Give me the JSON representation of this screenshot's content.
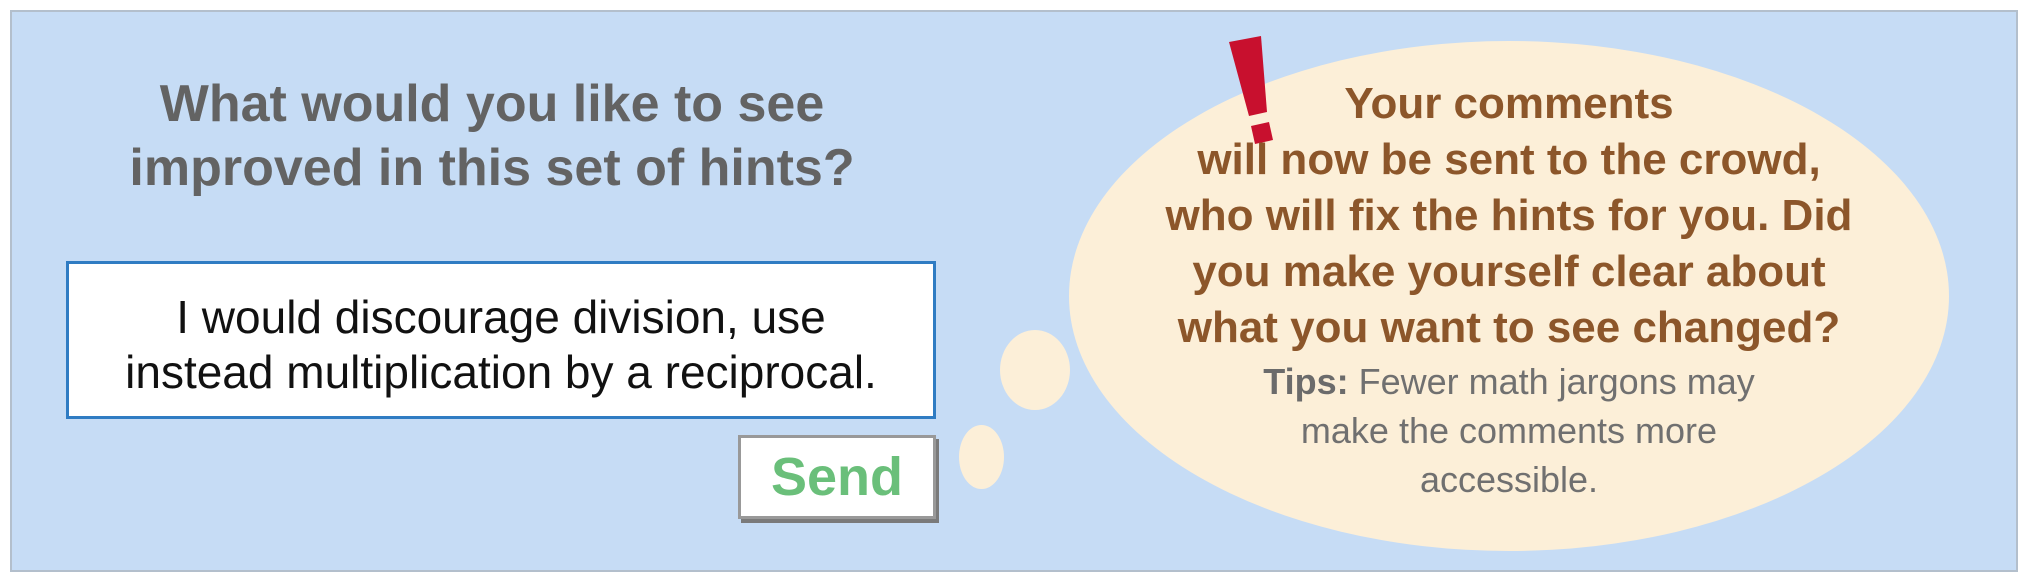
{
  "prompt": {
    "question_line1": "What would you like to see",
    "question_line2": "improved in this set of hints?"
  },
  "comment": {
    "value": "I would discourage division, use\ninstead multiplication by a reciprocal."
  },
  "send_button": {
    "label": "Send"
  },
  "bubble": {
    "icon": "exclamation-icon",
    "message_lines": [
      "Your comments",
      "will now be sent to the crowd,",
      "who will fix the hints for you. Did",
      "you make yourself clear about",
      "what you want to see changed?"
    ],
    "tips_label": "Tips:",
    "tips_line1": " Fewer math jargons may",
    "tips_line2": "make the comments more",
    "tips_line3": "accessible."
  },
  "colors": {
    "panel_bg": "#c6dcf5",
    "bubble_bg": "#fcefd8",
    "bubble_text": "#8c562a",
    "send_text": "#6abf7a",
    "textbox_border": "#2f7cc3",
    "exclaim": "#c8102e"
  }
}
